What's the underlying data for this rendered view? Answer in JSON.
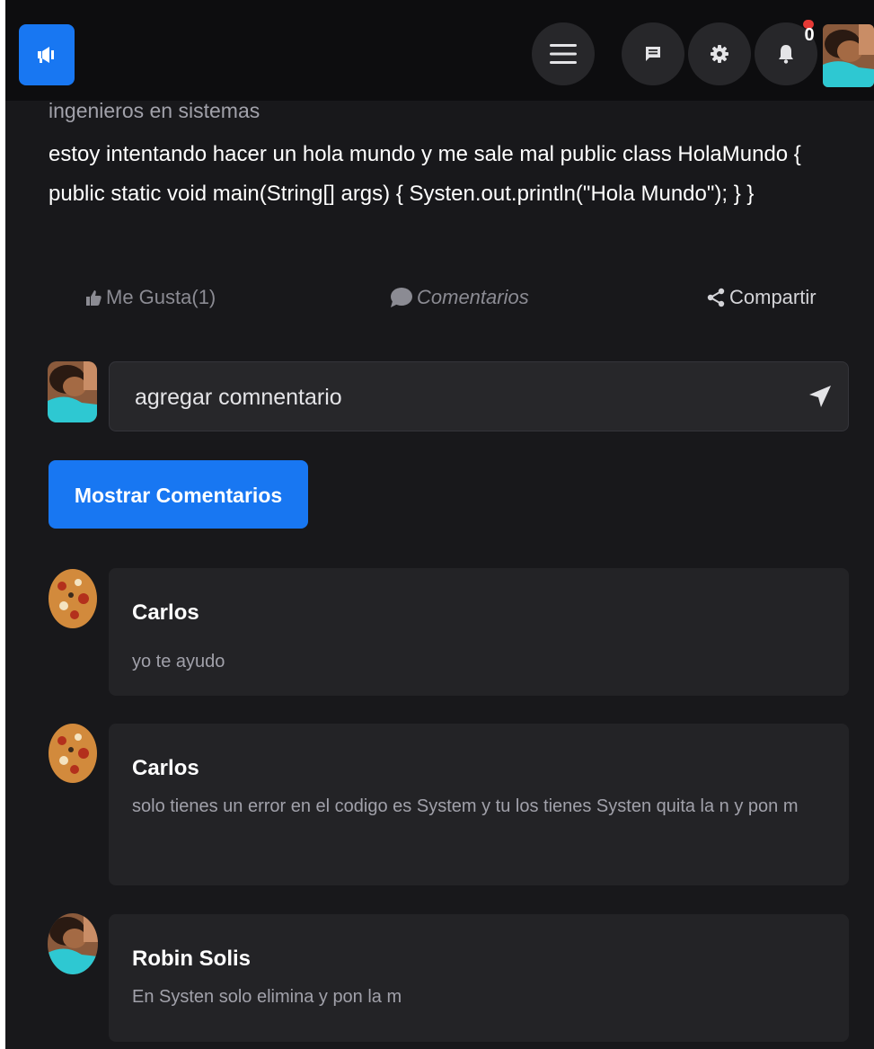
{
  "header": {
    "notification_count": "0",
    "accent_color": "#1877f2"
  },
  "post": {
    "category": "ingenieros en sistemas",
    "text": "estoy intentando hacer un hola mundo y me sale mal public class HolaMundo { public static void main(String[] args) { Systen.out.println(\"Hola Mundo\"); } }"
  },
  "actions": {
    "like_label": "Me Gusta(1)",
    "comments_label": "Comentarios",
    "share_label": "Compartir"
  },
  "comment_box": {
    "placeholder": "agregar comnentario"
  },
  "show_comments_button": "Mostrar Comentarios",
  "comments": [
    {
      "author": "Carlos",
      "text": "yo te ayudo"
    },
    {
      "author": "Carlos",
      "text": "solo tienes un error en el codigo es System y tu los tienes Systen quita la n y pon m"
    },
    {
      "author": "Robin Solis",
      "text": "En Systen solo elimina y pon la m"
    }
  ]
}
